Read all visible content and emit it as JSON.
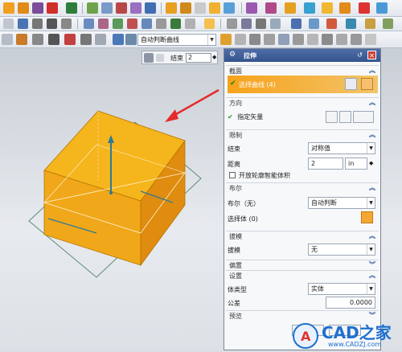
{
  "toolbar3": {
    "filter_value": "自动判断曲线"
  },
  "mini_toolbar": {
    "label": "结束",
    "value": "2"
  },
  "dialog": {
    "title": "拉伸",
    "sections": {
      "section": "截面",
      "direction": "方向",
      "limits": "限制",
      "boolean": "布尔",
      "draft": "拔模",
      "offset": "偏置",
      "settings": "设置",
      "preview": "预览"
    },
    "select_curve": "选择曲线 (4)",
    "specify_vector": "指定矢量",
    "end_label": "结束",
    "end_value": "对称值",
    "distance_label": "距离",
    "distance_value": "2",
    "distance_unit": "in",
    "open_profile": "开放轮廓智能体积",
    "boolean_label": "布尔（无）",
    "boolean_value": "自动判断",
    "select_body": "选择体 (0)",
    "draft_label": "拔模",
    "draft_value": "无",
    "body_type_label": "体类型",
    "body_type_value": "实体",
    "tolerance_label": "公差",
    "tolerance_value": "0.0000"
  },
  "watermark": {
    "brand": "CAD之家",
    "url": "www.CADZJ.com"
  },
  "colors": {
    "cube_top": "#f5b51c",
    "cube_side": "#e39512",
    "highlight": "#f7a21a",
    "title_bar": "#3e5d98",
    "arrow": "#e52b2b"
  }
}
